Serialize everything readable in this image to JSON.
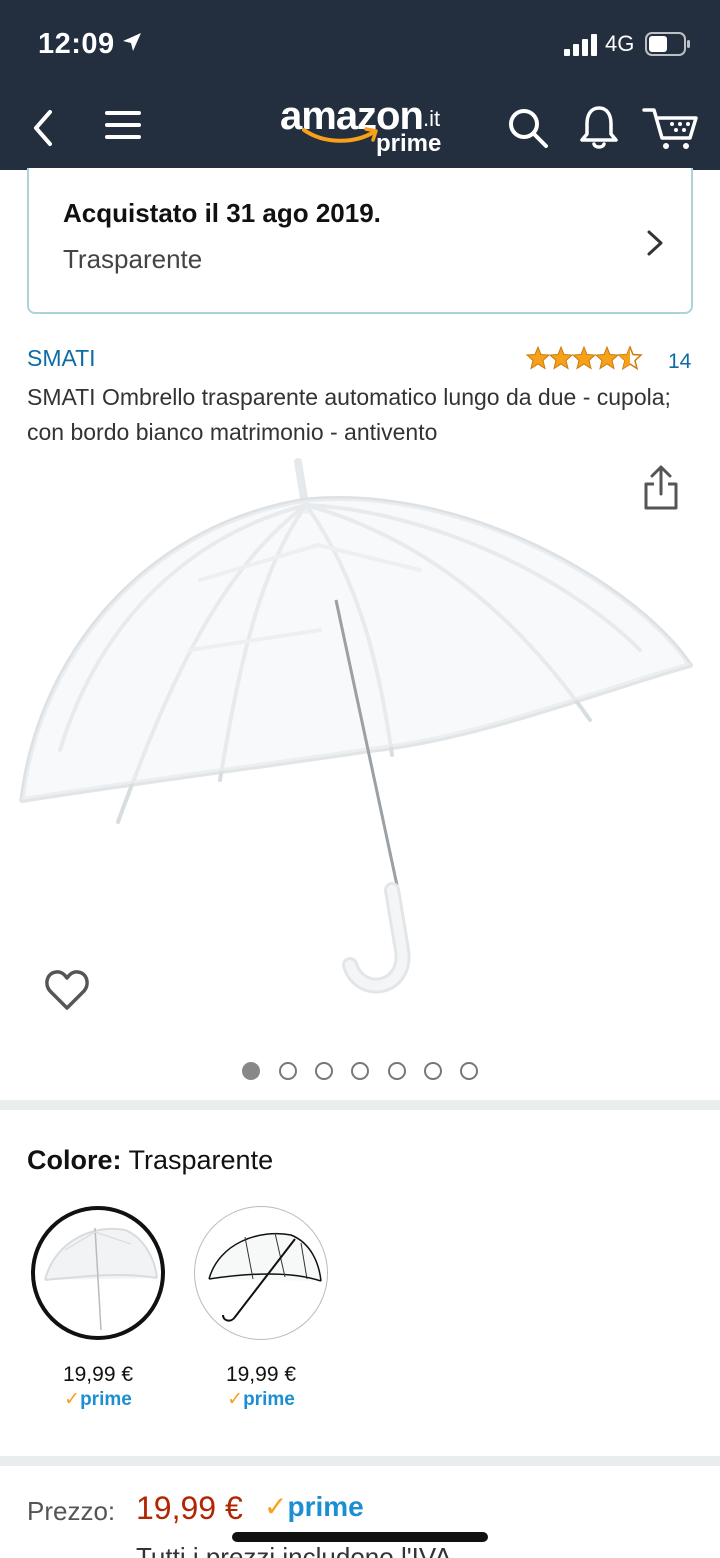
{
  "status_bar": {
    "time": "12:09",
    "network": "4G",
    "icons": [
      "location-arrow-icon",
      "signal-icon",
      "battery-icon"
    ]
  },
  "nav": {
    "logo": {
      "brand": "amazon",
      "tld": ".it",
      "sub": "prime"
    },
    "icons": [
      "back-icon",
      "menu-icon",
      "search-icon",
      "bell-icon",
      "cart-icon"
    ],
    "background_color": "#232f3e"
  },
  "purchase": {
    "title": "Acquistato il 31 ago 2019.",
    "subtitle": "Trasparente"
  },
  "product": {
    "brand": "SMATI",
    "rating": 4.5,
    "rating_max": 5,
    "review_count": "14",
    "title": "SMATI Ombrello trasparente automatico lungo da due - cupola; con bordo bianco matrimonio - antivento",
    "image_count": 7,
    "active_image": 1
  },
  "color": {
    "label": "Colore:",
    "value": "Trasparente",
    "options": [
      {
        "price": "19,99 €",
        "prime": "prime",
        "selected": true
      },
      {
        "price": "19,99 €",
        "prime": "prime",
        "selected": false
      }
    ]
  },
  "price": {
    "label": "Prezzo:",
    "value": "19,99 €",
    "prime": "prime",
    "note": "Tutti i prezzi includono l'IVA."
  },
  "colors": {
    "link": "#0d6ba6",
    "price": "#b12704",
    "prime_blue": "#1b8fd1",
    "prime_check": "#f7a11a",
    "card_border": "#a9d4d9"
  }
}
